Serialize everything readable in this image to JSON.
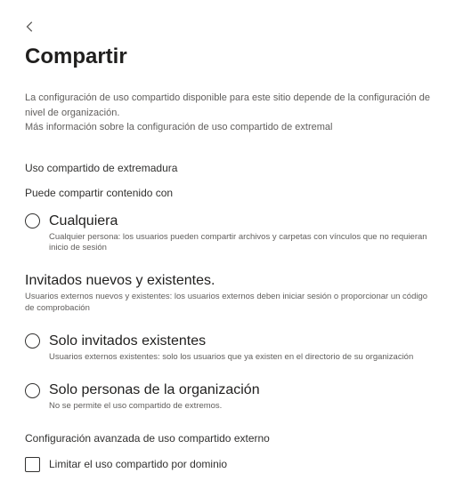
{
  "header": {
    "title": "Compartir"
  },
  "intro": {
    "text": "La configuración de uso compartido disponible para este sitio depende de la configuración de nivel de organización.",
    "link": "Más información sobre la configuración de uso compartido de extremal"
  },
  "external_sharing": {
    "section_label": "Uso compartido de extremadura",
    "sub_label": "Puede compartir contenido con",
    "options": [
      {
        "title": "Cualquiera",
        "desc": "Cualquier persona: los usuarios pueden compartir archivos y carpetas con vínculos que no requieran inicio de sesión"
      },
      {
        "title": "Invitados nuevos y existentes.",
        "desc": "Usuarios externos nuevos y existentes: los usuarios externos deben iniciar sesión o proporcionar un código de comprobación"
      },
      {
        "title": "Solo invitados existentes",
        "desc": "Usuarios externos existentes: solo los usuarios que ya existen en el directorio de su organización"
      },
      {
        "title": "Solo personas de la organización",
        "desc": "No se permite el uso compartido de extremos."
      }
    ]
  },
  "advanced": {
    "label": "Configuración avanzada de uso compartido externo",
    "limit_by_domain": "Limitar el uso compartido por dominio"
  }
}
